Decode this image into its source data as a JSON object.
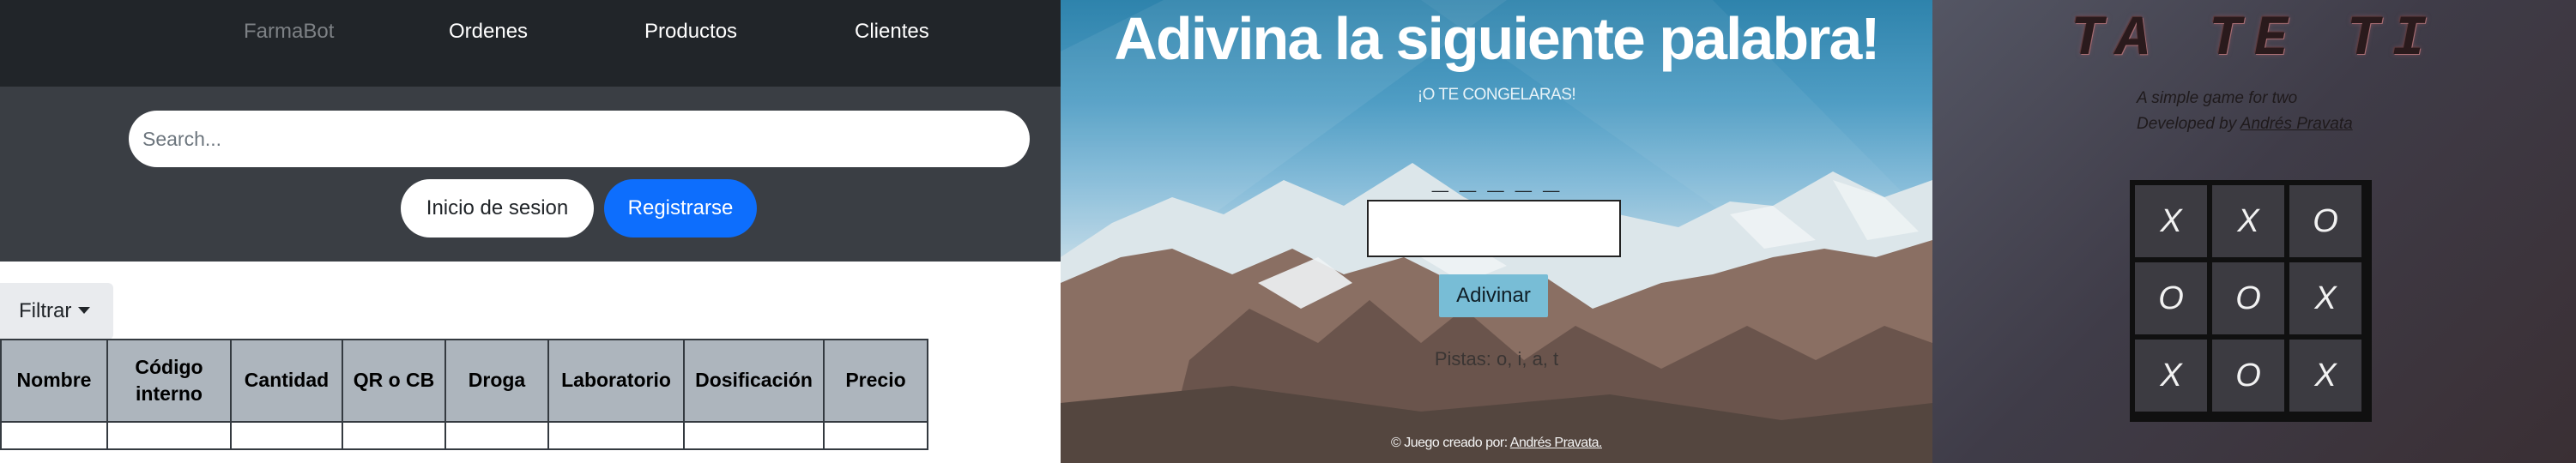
{
  "farmabot": {
    "nav": {
      "brand": "FarmaBot",
      "items": [
        "Ordenes",
        "Productos",
        "Clientes"
      ]
    },
    "search": {
      "placeholder": "Search..."
    },
    "buttons": {
      "login": "Inicio de sesion",
      "register": "Registrarse"
    },
    "filter": {
      "label": "Filtrar"
    },
    "table": {
      "headers": [
        "Nombre",
        "Código interno",
        "Cantidad",
        "QR o CB",
        "Droga",
        "Laboratorio",
        "Dosificación",
        "Precio"
      ]
    }
  },
  "word_game": {
    "title": "Adivina la siguiente palabra!",
    "subtitle": "¡O TE CONGELARAS!",
    "dashes": "_ _ _ _ _",
    "guess_input": {
      "value": "",
      "placeholder": ""
    },
    "button": "Adivinar",
    "hints": "Pistas: o, i, a, t",
    "footer": {
      "text": "© Juego creado por: ",
      "author": "Andrés Pravata."
    }
  },
  "tateti": {
    "title": "TA TE TI",
    "tagline": "A simple game for two",
    "developed_by": "Developed by ",
    "author": "Andrés Pravata",
    "board": [
      [
        "X",
        "X",
        "O"
      ],
      [
        "O",
        "O",
        "X"
      ],
      [
        "X",
        "O",
        "X"
      ]
    ]
  },
  "colors": {
    "nav_dark": "#212529",
    "band_gray": "#3a3e44",
    "primary_blue": "#0d6efd",
    "table_header": "#adb5bd",
    "adivinar_button": "#78bdd6",
    "tateti_cell": "#3c3b41"
  }
}
